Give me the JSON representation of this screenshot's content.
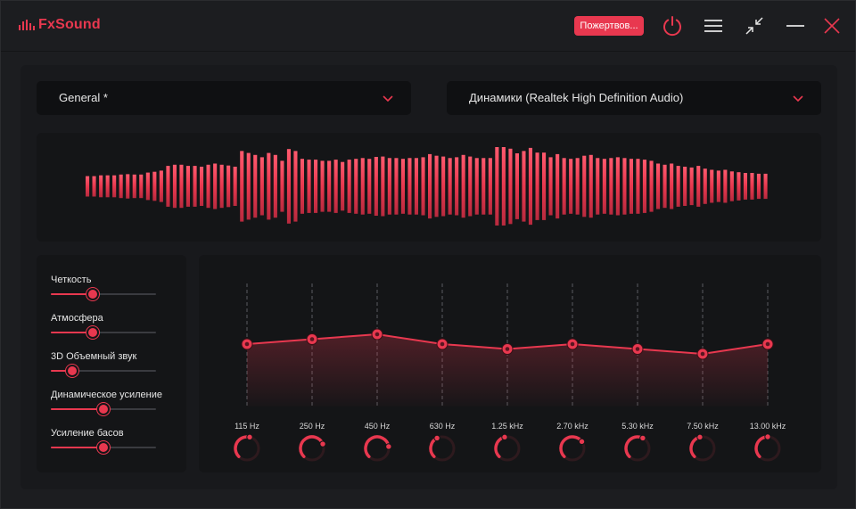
{
  "app": {
    "name": "FxSound"
  },
  "toolbar": {
    "donate_label": "Пожертвов..."
  },
  "preset": {
    "value": "General *"
  },
  "output": {
    "value": "Динамики (Realtek High Definition Audio)"
  },
  "effects": [
    {
      "label": "Четкость",
      "value": 0.4
    },
    {
      "label": "Атмосфера",
      "value": 0.4
    },
    {
      "label": "3D Объемный звук",
      "value": 0.2
    },
    {
      "label": "Динамическое усиление",
      "value": 0.5
    },
    {
      "label": "Усиление басов",
      "value": 0.5
    }
  ],
  "eq": {
    "bands": [
      {
        "freq": "115 Hz",
        "gain": 0.0,
        "knob": 0.55
      },
      {
        "freq": "250 Hz",
        "gain": 1.0,
        "knob": 0.75
      },
      {
        "freq": "450 Hz",
        "gain": 2.0,
        "knob": 0.8
      },
      {
        "freq": "630 Hz",
        "gain": 0.0,
        "knob": 0.4
      },
      {
        "freq": "1.25 kHz",
        "gain": -1.0,
        "knob": 0.45
      },
      {
        "freq": "2.70 kHz",
        "gain": 0.0,
        "knob": 0.7
      },
      {
        "freq": "5.30 kHz",
        "gain": -1.0,
        "knob": 0.6
      },
      {
        "freq": "7.50 kHz",
        "gain": -2.0,
        "knob": 0.45
      },
      {
        "freq": "13.00 kHz",
        "gain": 0.0,
        "knob": 0.5
      }
    ]
  },
  "visualizer": {
    "levels": [
      0.26,
      0.26,
      0.28,
      0.28,
      0.28,
      0.3,
      0.31,
      0.3,
      0.3,
      0.35,
      0.37,
      0.4,
      0.52,
      0.55,
      0.55,
      0.52,
      0.52,
      0.5,
      0.55,
      0.58,
      0.55,
      0.53,
      0.5,
      0.9,
      0.85,
      0.8,
      0.74,
      0.85,
      0.8,
      0.65,
      0.95,
      0.9,
      0.7,
      0.68,
      0.68,
      0.65,
      0.65,
      0.68,
      0.62,
      0.68,
      0.7,
      0.72,
      0.7,
      0.75,
      0.76,
      0.72,
      0.72,
      0.7,
      0.72,
      0.72,
      0.74,
      0.82,
      0.78,
      0.76,
      0.72,
      0.74,
      0.8,
      0.76,
      0.72,
      0.72,
      0.72,
      1.0,
      1.0,
      0.96,
      0.84,
      0.9,
      0.98,
      0.86,
      0.86,
      0.74,
      0.82,
      0.72,
      0.7,
      0.72,
      0.78,
      0.8,
      0.72,
      0.7,
      0.72,
      0.74,
      0.72,
      0.7,
      0.7,
      0.68,
      0.65,
      0.58,
      0.55,
      0.58,
      0.52,
      0.5,
      0.48,
      0.52,
      0.45,
      0.42,
      0.4,
      0.42,
      0.38,
      0.36,
      0.34,
      0.34,
      0.32,
      0.32
    ],
    "color": "#e8384f"
  },
  "colors": {
    "accent": "#e8384f",
    "panel": "#141517",
    "background": "#1c1d20"
  }
}
